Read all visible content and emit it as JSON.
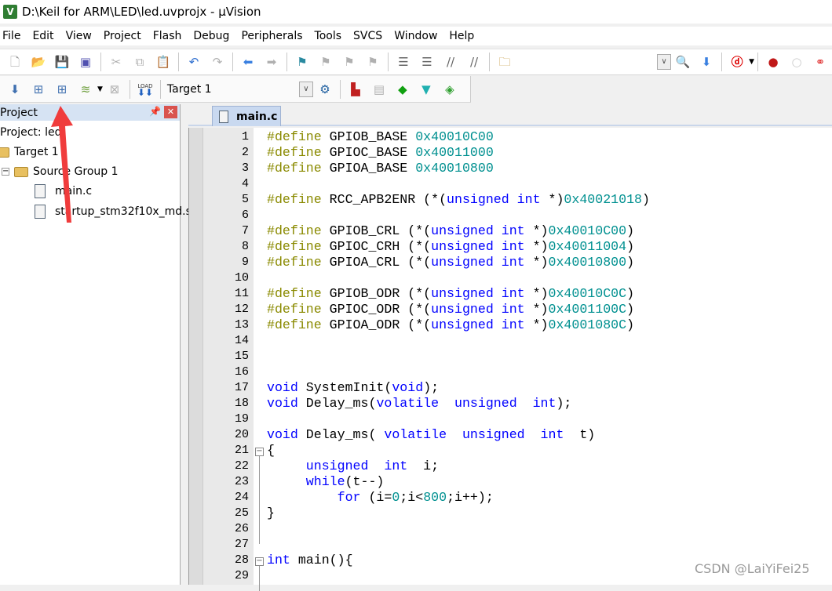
{
  "window": {
    "title": "D:\\Keil for ARM\\LED\\led.uvprojx - µVision",
    "app_icon": "V"
  },
  "menu": [
    "File",
    "Edit",
    "View",
    "Project",
    "Flash",
    "Debug",
    "Peripherals",
    "Tools",
    "SVCS",
    "Window",
    "Help"
  ],
  "build_toolbar": {
    "target": "Target 1",
    "load_label": "LOAD"
  },
  "project_panel": {
    "title": "Project",
    "root": "Project: led",
    "target": "Target 1",
    "group": "Source Group 1",
    "files": [
      "main.c",
      "startup_stm32f10x_md.s"
    ]
  },
  "editor": {
    "active_tab": "main.c",
    "lines": [
      {
        "n": "1",
        "tokens": [
          [
            "#define ",
            "p"
          ],
          [
            "GPIOB_BASE ",
            "t"
          ],
          [
            "0x40010C00",
            "n"
          ]
        ]
      },
      {
        "n": "2",
        "tokens": [
          [
            "#define ",
            "p"
          ],
          [
            "GPIOC_BASE ",
            "t"
          ],
          [
            "0x40011000",
            "n"
          ]
        ]
      },
      {
        "n": "3",
        "tokens": [
          [
            "#define ",
            "p"
          ],
          [
            "GPIOA_BASE ",
            "t"
          ],
          [
            "0x40010800",
            "n"
          ]
        ]
      },
      {
        "n": "4",
        "tokens": []
      },
      {
        "n": "5",
        "tokens": [
          [
            "#define ",
            "p"
          ],
          [
            "RCC_APB2ENR (*(",
            "t"
          ],
          [
            "unsigned int",
            "k"
          ],
          [
            " *)",
            "t"
          ],
          [
            "0x40021018",
            "n"
          ],
          [
            ")",
            "t"
          ]
        ]
      },
      {
        "n": "6",
        "tokens": []
      },
      {
        "n": "7",
        "tokens": [
          [
            "#define ",
            "p"
          ],
          [
            "GPIOB_CRL (*(",
            "t"
          ],
          [
            "unsigned int",
            "k"
          ],
          [
            " *)",
            "t"
          ],
          [
            "0x40010C00",
            "n"
          ],
          [
            ")",
            "t"
          ]
        ]
      },
      {
        "n": "8",
        "tokens": [
          [
            "#define ",
            "p"
          ],
          [
            "GPIOC_CRH (*(",
            "t"
          ],
          [
            "unsigned int",
            "k"
          ],
          [
            " *)",
            "t"
          ],
          [
            "0x40011004",
            "n"
          ],
          [
            ")",
            "t"
          ]
        ]
      },
      {
        "n": "9",
        "tokens": [
          [
            "#define ",
            "p"
          ],
          [
            "GPIOA_CRL (*(",
            "t"
          ],
          [
            "unsigned int",
            "k"
          ],
          [
            " *)",
            "t"
          ],
          [
            "0x40010800",
            "n"
          ],
          [
            ")",
            "t"
          ]
        ]
      },
      {
        "n": "10",
        "tokens": []
      },
      {
        "n": "11",
        "tokens": [
          [
            "#define ",
            "p"
          ],
          [
            "GPIOB_ODR (*(",
            "t"
          ],
          [
            "unsigned int",
            "k"
          ],
          [
            " *)",
            "t"
          ],
          [
            "0x40010C0C",
            "n"
          ],
          [
            ")",
            "t"
          ]
        ]
      },
      {
        "n": "12",
        "tokens": [
          [
            "#define ",
            "p"
          ],
          [
            "GPIOC_ODR (*(",
            "t"
          ],
          [
            "unsigned int",
            "k"
          ],
          [
            " *)",
            "t"
          ],
          [
            "0x4001100C",
            "n"
          ],
          [
            ")",
            "t"
          ]
        ]
      },
      {
        "n": "13",
        "tokens": [
          [
            "#define ",
            "p"
          ],
          [
            "GPIOA_ODR (*(",
            "t"
          ],
          [
            "unsigned int",
            "k"
          ],
          [
            " *)",
            "t"
          ],
          [
            "0x4001080C",
            "n"
          ],
          [
            ")",
            "t"
          ]
        ]
      },
      {
        "n": "14",
        "tokens": []
      },
      {
        "n": "15",
        "tokens": []
      },
      {
        "n": "16",
        "tokens": []
      },
      {
        "n": "17",
        "tokens": [
          [
            "void",
            "k"
          ],
          [
            " SystemInit(",
            "t"
          ],
          [
            "void",
            "k"
          ],
          [
            ");",
            "t"
          ]
        ]
      },
      {
        "n": "18",
        "tokens": [
          [
            "void",
            "k"
          ],
          [
            " Delay_ms(",
            "t"
          ],
          [
            "volatile  unsigned  int",
            "k"
          ],
          [
            ");",
            "t"
          ]
        ]
      },
      {
        "n": "19",
        "tokens": []
      },
      {
        "n": "20",
        "tokens": [
          [
            "void",
            "k"
          ],
          [
            " Delay_ms( ",
            "t"
          ],
          [
            "volatile  unsigned  int",
            "k"
          ],
          [
            "  t)",
            "t"
          ]
        ]
      },
      {
        "n": "21",
        "tokens": [
          [
            "{",
            "t"
          ]
        ]
      },
      {
        "n": "22",
        "tokens": [
          [
            "     ",
            "t"
          ],
          [
            "unsigned  int",
            "k"
          ],
          [
            "  i;",
            "t"
          ]
        ]
      },
      {
        "n": "23",
        "tokens": [
          [
            "     ",
            "t"
          ],
          [
            "while",
            "k"
          ],
          [
            "(t--)",
            "t"
          ]
        ]
      },
      {
        "n": "24",
        "tokens": [
          [
            "         ",
            "t"
          ],
          [
            "for",
            "k"
          ],
          [
            " (i=",
            "t"
          ],
          [
            "0",
            "n"
          ],
          [
            ";i<",
            "t"
          ],
          [
            "800",
            "n"
          ],
          [
            ";i++);",
            "t"
          ]
        ]
      },
      {
        "n": "25",
        "tokens": [
          [
            "}",
            "t"
          ]
        ]
      },
      {
        "n": "26",
        "tokens": []
      },
      {
        "n": "27",
        "tokens": []
      },
      {
        "n": "28",
        "tokens": [
          [
            "int",
            "k"
          ],
          [
            " main(){",
            "t"
          ]
        ]
      },
      {
        "n": "29",
        "tokens": []
      }
    ]
  },
  "watermark": "CSDN @LaiYiFei25",
  "colors": {
    "preprocessor": "#8a8a00",
    "keyword": "#0000ff",
    "number": "#009090",
    "arrow": "#f03c3c"
  }
}
